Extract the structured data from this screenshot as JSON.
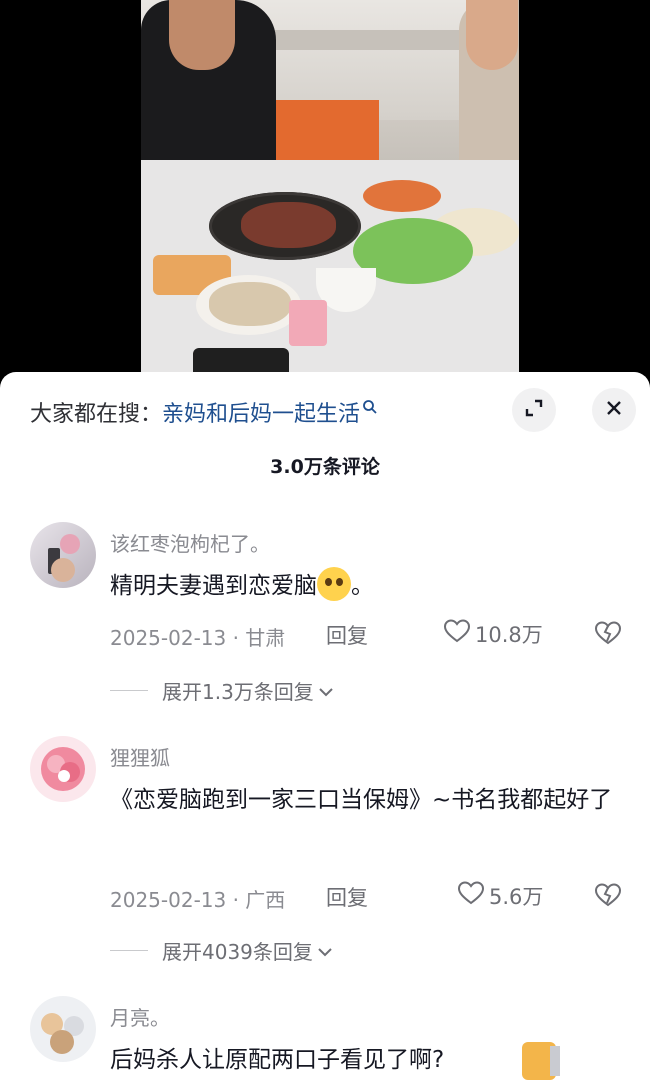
{
  "search": {
    "prefix": "大家都在搜：",
    "term": "亲妈和后妈一起生活"
  },
  "comments_count": "3.0万条评论",
  "comments": [
    {
      "username": "该红枣泡枸杞了。",
      "text": "精明夫妻遇到恋爱脑",
      "text_suffix": "。",
      "date_location": "2025-02-13 · 甘肃",
      "reply_label": "回复",
      "likes": "10.8万",
      "expand_label": "展开1.3万条回复"
    },
    {
      "username": "狸狸狐",
      "text": "《恋爱脑跑到一家三口当保姆》~书名我都起好了",
      "date_location": "2025-02-13 · 广西",
      "reply_label": "回复",
      "likes": "5.6万",
      "expand_label": "展开4039条回复"
    },
    {
      "username": "月亮。",
      "text": "后妈杀人让原配两口子看见了啊?"
    }
  ],
  "icons": {
    "search_hint": "search-icon",
    "expand": "expand-icon",
    "close": "close-icon",
    "like": "heart-icon",
    "dislike": "broken-heart-icon",
    "expand_chevron": "chevron-down-icon"
  },
  "colors": {
    "search_term": "#1f4f8f",
    "muted_text": "#8a8b91",
    "sheet_bg": "#ffffff"
  }
}
